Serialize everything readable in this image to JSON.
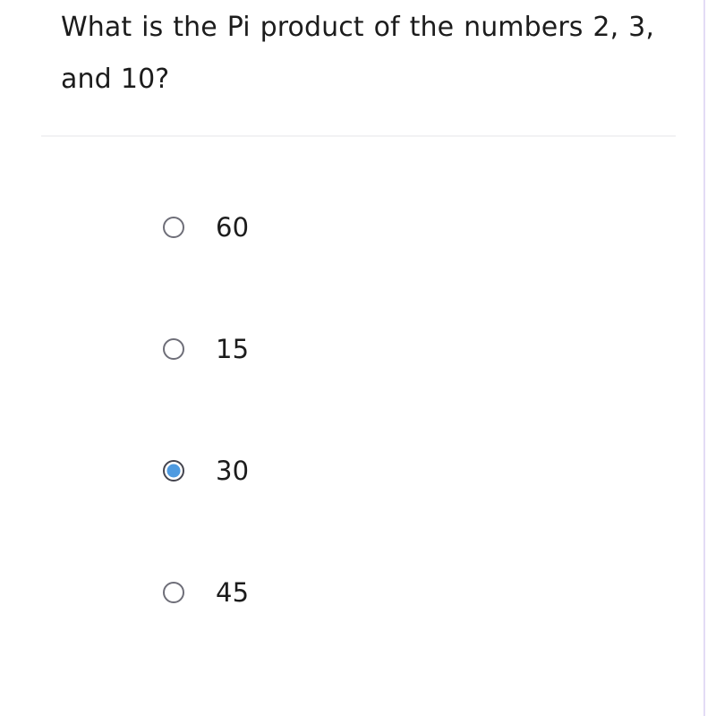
{
  "question": {
    "text": "What is the Pi product of the numbers 2, 3, and 10?"
  },
  "divider": {
    "color": "#f2f2f4"
  },
  "edge_rule": {
    "color": "#e3dcf5"
  },
  "colors": {
    "text": "#1c1c1c",
    "radio_border": "#6e6e78",
    "radio_border_selected": "#44444e",
    "radio_dot_selected": "#4e9ae0",
    "background": "#ffffff"
  },
  "options": [
    {
      "label": "60",
      "selected": false
    },
    {
      "label": "15",
      "selected": false
    },
    {
      "label": "30",
      "selected": true
    },
    {
      "label": "45",
      "selected": false
    }
  ],
  "selected_option": "30"
}
